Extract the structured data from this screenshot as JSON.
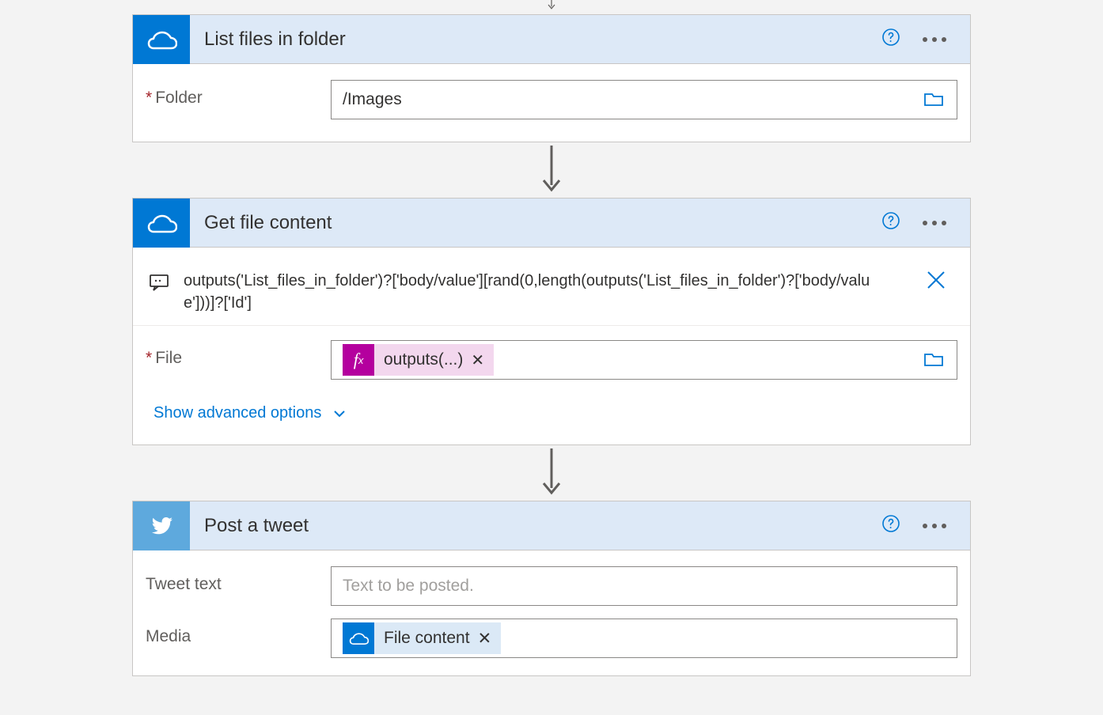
{
  "steps": {
    "list_files": {
      "title": "List files in folder",
      "folder_label": "Folder",
      "folder_value": "/Images"
    },
    "get_file": {
      "title": "Get file content",
      "expression": "outputs('List_files_in_folder')?['body/value'][rand(0,length(outputs('List_files_in_folder')?['body/value']))]?['Id']",
      "file_label": "File",
      "fx_token_label": "outputs(...)",
      "advanced_label": "Show advanced options"
    },
    "post_tweet": {
      "title": "Post a tweet",
      "tweet_text_label": "Tweet text",
      "tweet_text_placeholder": "Text to be posted.",
      "media_label": "Media",
      "media_token_label": "File content"
    }
  }
}
